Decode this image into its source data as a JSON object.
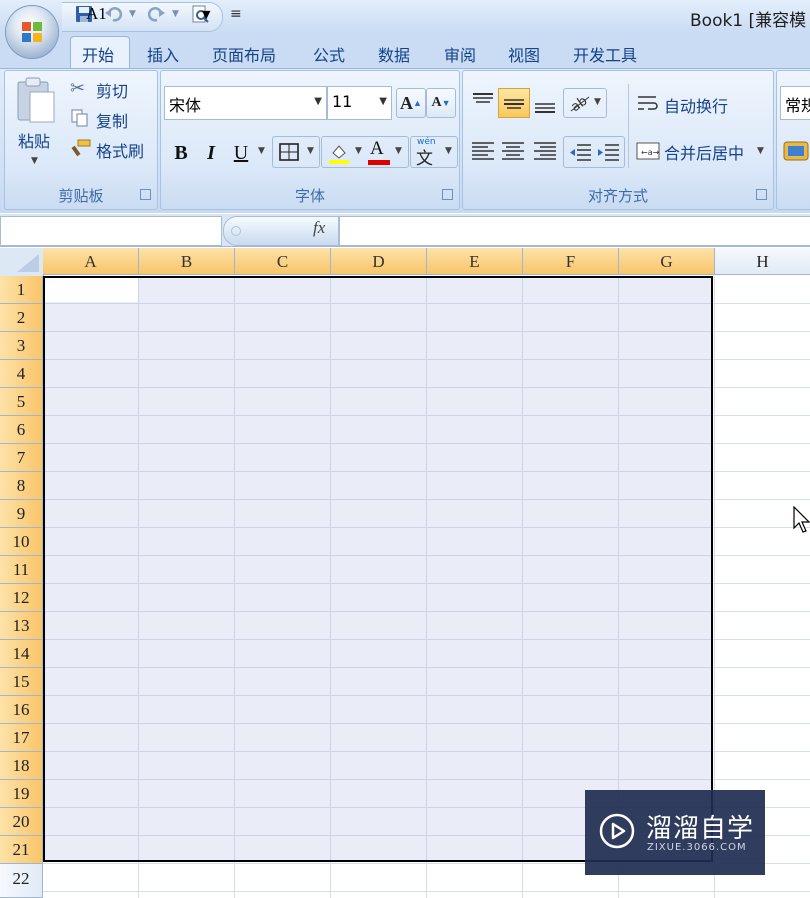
{
  "window": {
    "title": "Book1  [兼容模"
  },
  "tabs": [
    {
      "label": "开始",
      "active": true
    },
    {
      "label": "插入"
    },
    {
      "label": "页面布局"
    },
    {
      "label": "公式"
    },
    {
      "label": "数据"
    },
    {
      "label": "审阅"
    },
    {
      "label": "视图"
    },
    {
      "label": "开发工具"
    }
  ],
  "clipboard": {
    "paste": "粘贴",
    "cut": "剪切",
    "copy": "复制",
    "format_painter": "格式刷",
    "group_label": "剪贴板"
  },
  "font": {
    "name": "宋体",
    "size": "11",
    "bold": "B",
    "italic": "I",
    "underline": "U",
    "color_letter": "A",
    "grow": "A",
    "shrink": "A",
    "phonetic": "wén",
    "phonetic_char": "文",
    "group_label": "字体",
    "highlight_color": "#ffff00",
    "font_color": "#e00000"
  },
  "alignment": {
    "wrap": "自动换行",
    "merge": "合并后居中",
    "group_label": "对齐方式"
  },
  "number": {
    "format": "常规"
  },
  "formula_bar": {
    "name_box": "A1",
    "fx": "fx",
    "formula": ""
  },
  "columns": [
    "A",
    "B",
    "C",
    "D",
    "E",
    "F",
    "G",
    "H"
  ],
  "rows": [
    "1",
    "2",
    "3",
    "4",
    "5",
    "6",
    "7",
    "8",
    "9",
    "10",
    "11",
    "12",
    "13",
    "14",
    "15",
    "16",
    "17",
    "18",
    "19",
    "20",
    "21",
    "22"
  ],
  "selection": {
    "range": "A1:G21"
  },
  "watermark": {
    "cn": "溜溜自学",
    "en": "ZIXUE.3066.COM"
  }
}
